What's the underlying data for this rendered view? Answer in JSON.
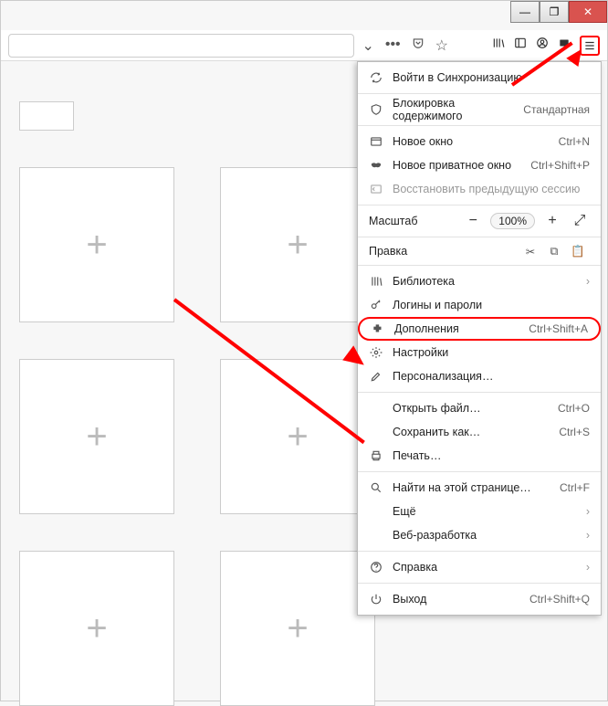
{
  "window": {
    "minimize": "—",
    "maximize": "❐",
    "close": "✕"
  },
  "toolbar": {
    "dropdown_chevron": "⌄",
    "dots": "•••",
    "shield": "⛉",
    "star": "☆",
    "library": "|||\\",
    "reader": "▭",
    "account": "◉",
    "screenshot": "▣",
    "hamburger": "≡"
  },
  "tiles": {
    "plus": "+"
  },
  "menu": {
    "sync": "Войти в Синхронизацию",
    "block": "Блокировка содержимого",
    "block_mode": "Стандартная",
    "new_window": "Новое окно",
    "new_window_sc": "Ctrl+N",
    "private": "Новое приватное окно",
    "private_sc": "Ctrl+Shift+P",
    "restore": "Восстановить предыдущую сессию",
    "zoom_label": "Масштаб",
    "zoom_minus": "−",
    "zoom_val": "100%",
    "zoom_plus": "+",
    "zoom_full": "⤢",
    "edit_label": "Правка",
    "cut": "✂",
    "copy": "⧉",
    "paste": "📋",
    "library": "Библиотека",
    "logins": "Логины и пароли",
    "addons": "Дополнения",
    "addons_sc": "Ctrl+Shift+A",
    "settings": "Настройки",
    "customize": "Персонализация…",
    "open_file": "Открыть файл…",
    "open_file_sc": "Ctrl+O",
    "save_as": "Сохранить как…",
    "save_as_sc": "Ctrl+S",
    "print": "Печать…",
    "find": "Найти на этой странице…",
    "find_sc": "Ctrl+F",
    "more": "Ещё",
    "webdev": "Веб-разработка",
    "help": "Справка",
    "exit": "Выход",
    "exit_sc": "Ctrl+Shift+Q",
    "chevron": "›"
  }
}
